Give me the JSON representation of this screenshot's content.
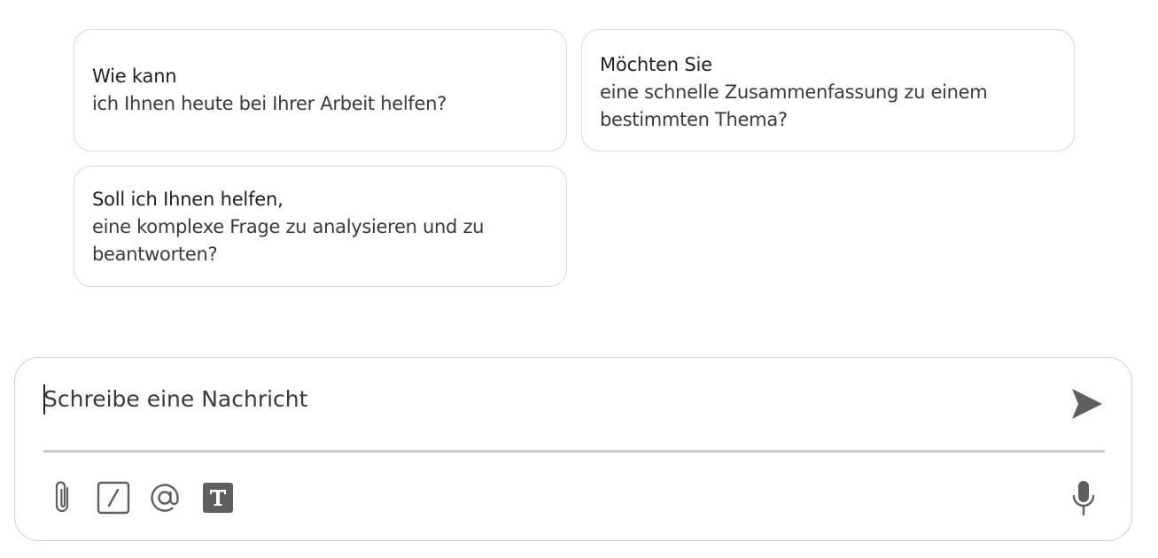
{
  "suggestions": [
    {
      "title": "Wie kann",
      "body": "ich Ihnen heute bei Ihrer Arbeit helfen?"
    },
    {
      "title": "Möchten Sie",
      "body": "eine schnelle Zusammenfassung zu einem bestimmten Thema?"
    },
    {
      "title": "Soll ich Ihnen helfen,",
      "body": "eine komplexe Frage zu analysieren und zu beantworten?"
    }
  ],
  "composer": {
    "placeholder": "Schreibe eine Nachricht",
    "value": ""
  },
  "icons": {
    "send": "send-icon",
    "attach": "paperclip-icon",
    "slash": "slash-command-icon",
    "mention": "at-sign-icon",
    "text": "text-format-icon",
    "mic": "microphone-icon"
  },
  "colors": {
    "icon": "#5f5f5f",
    "border": "#d9d9d9",
    "divider": "#c9c9c9"
  }
}
